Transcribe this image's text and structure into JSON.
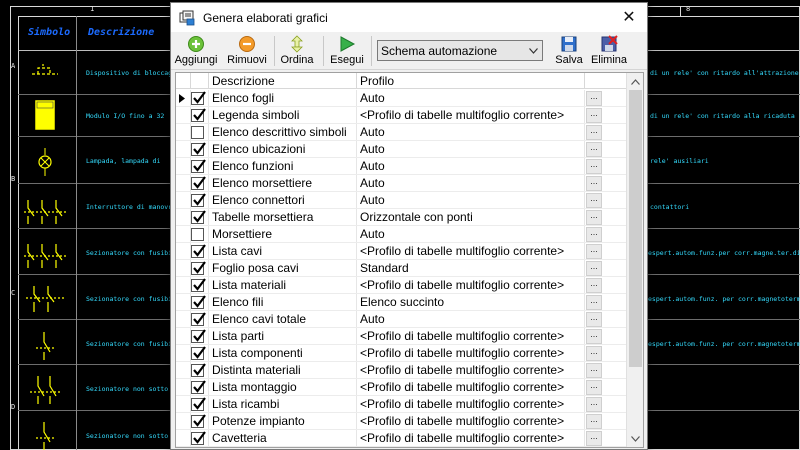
{
  "background": {
    "ruler_numbers": [
      "1",
      "8"
    ],
    "row_letters": [
      "A",
      "B",
      "C",
      "D"
    ],
    "table_header": {
      "symbol": "Simbolo",
      "description": "Descrizione"
    },
    "descriptions_left": [
      "Dispositivo di bloccag",
      "Modulo I/O fino a 32",
      "Lampada, lampada di",
      "Interruttore di manovr",
      "Sezionatore con fusibi",
      "Sezionatore con fusibi",
      "Sezionatore con fusibi",
      "Sezionatore non sotto",
      "Sezionatore non sotto"
    ],
    "descriptions_right": [
      "di un rele' con ritardo all'attrazione",
      "di un rele' con ritardo alla ricaduta",
      "rele' ausiliari",
      "contattori",
      "espert.autom.funz.per corr.magne.ter.diff.",
      "espert.autom.funz. per corr.magnetoterm.",
      "espert.autom.funz. per corr.magnetoterm."
    ],
    "colors": {
      "header": "#1c6bff",
      "text": "#35ddff",
      "symbols": "#ffff00"
    }
  },
  "dialog": {
    "title": "Genera elaborati grafici",
    "close_symbol": "✕",
    "toolbar": {
      "add_label": "Aggiungi",
      "remove_label": "Rimuovi",
      "sort_label": "Ordina",
      "run_label": "Esegui",
      "schema_selected": "Schema automazione",
      "save_label": "Salva",
      "delete_label": "Elimina"
    },
    "grid": {
      "col_description": "Descrizione",
      "col_profile": "Profilo",
      "current_row_index": 0,
      "rows": [
        {
          "checked": true,
          "description": "Elenco fogli",
          "profile": "Auto"
        },
        {
          "checked": true,
          "description": "Legenda simboli",
          "profile": "<Profilo di tabelle multifoglio corrente>"
        },
        {
          "checked": false,
          "description": "Elenco descrittivo simboli",
          "profile": "Auto"
        },
        {
          "checked": true,
          "description": "Elenco ubicazioni",
          "profile": "Auto"
        },
        {
          "checked": true,
          "description": "Elenco funzioni",
          "profile": "Auto"
        },
        {
          "checked": true,
          "description": "Elenco morsettiere",
          "profile": "Auto"
        },
        {
          "checked": true,
          "description": "Elenco connettori",
          "profile": "Auto"
        },
        {
          "checked": true,
          "description": "Tabelle morsettiera",
          "profile": "Orizzontale con ponti"
        },
        {
          "checked": false,
          "description": "Morsettiere",
          "profile": "Auto"
        },
        {
          "checked": true,
          "description": "Lista cavi",
          "profile": "<Profilo di tabelle multifoglio corrente>"
        },
        {
          "checked": true,
          "description": "Foglio posa cavi",
          "profile": "Standard"
        },
        {
          "checked": true,
          "description": "Lista materiali",
          "profile": "<Profilo di tabelle multifoglio corrente>"
        },
        {
          "checked": true,
          "description": "Elenco fili",
          "profile": "Elenco succinto"
        },
        {
          "checked": true,
          "description": "Elenco cavi totale",
          "profile": "Auto"
        },
        {
          "checked": true,
          "description": "Lista parti",
          "profile": "<Profilo di tabelle multifoglio corrente>"
        },
        {
          "checked": true,
          "description": "Lista componenti",
          "profile": "<Profilo di tabelle multifoglio corrente>"
        },
        {
          "checked": true,
          "description": "Distinta materiali",
          "profile": "<Profilo di tabelle multifoglio corrente>"
        },
        {
          "checked": true,
          "description": "Lista montaggio",
          "profile": "<Profilo di tabelle multifoglio corrente>"
        },
        {
          "checked": true,
          "description": "Lista ricambi",
          "profile": "<Profilo di tabelle multifoglio corrente>"
        },
        {
          "checked": true,
          "description": "Potenze impianto",
          "profile": "<Profilo di tabelle multifoglio corrente>"
        },
        {
          "checked": true,
          "description": "Cavetteria",
          "profile": "<Profilo di tabelle multifoglio corrente>"
        }
      ],
      "ellipsis": "..."
    }
  }
}
